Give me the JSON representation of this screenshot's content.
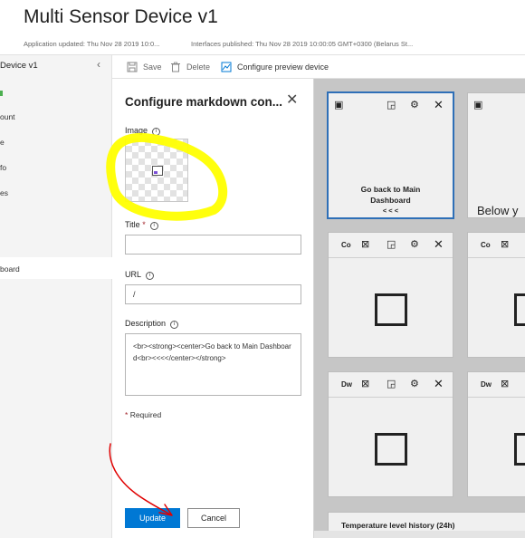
{
  "header": {
    "title": "Multi Sensor Device v1",
    "updated": "Application updated: Thu Nov 28 2019 10:0...",
    "published": "Interfaces published: Thu Nov 28 2019 10:00:05 GMT+0300 (Belarus St..."
  },
  "leftnav": {
    "title": "Device v1",
    "items": [
      "ount",
      "e",
      "fo",
      "es",
      "board"
    ]
  },
  "toolbar": {
    "save": "Save",
    "delete": "Delete",
    "configure": "Configure preview device"
  },
  "panel": {
    "title": "Configure markdown con...",
    "image_label": "Image",
    "title_label": "Title",
    "title_required": "*",
    "title_value": "",
    "url_label": "URL",
    "url_value": "/",
    "description_label": "Description",
    "description_value": "<br><strong><center>Go back to Main Dashboard<br><<<</center></strong>",
    "required_star": "*",
    "required_text": "Required",
    "update": "Update",
    "cancel": "Cancel"
  },
  "dashboard": {
    "tile1_text_line1": "Go back to Main",
    "tile1_text_line2": "Dashboard",
    "tile1_text_line3": "< < <",
    "tile2_text": "Below y",
    "tile3_name": "Co",
    "tile4_name": "Co",
    "tile5_name": "Dw",
    "tile6_name": "Dw",
    "bottom_card": "Temperature level history (24h)"
  },
  "colors": {
    "primary": "#0078d4",
    "highlight": "#ffff00",
    "annotation": "#e00000",
    "selected_border": "#2e6fb7"
  }
}
